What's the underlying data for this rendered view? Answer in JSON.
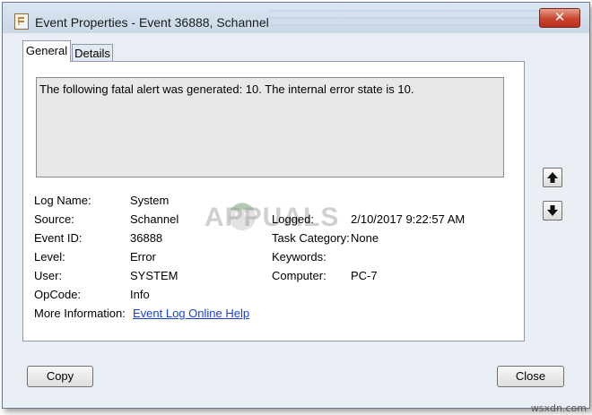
{
  "window": {
    "title": "Event Properties - Event 36888, Schannel",
    "close_label": "✕"
  },
  "tabs": [
    {
      "label": "General",
      "active": true
    },
    {
      "label": "Details",
      "active": false
    }
  ],
  "description": "The following fatal alert was generated: 10. The internal error state is 10.",
  "fields": {
    "log_name": {
      "label": "Log Name:",
      "value": "System"
    },
    "source": {
      "label": "Source:",
      "value": "Schannel"
    },
    "event_id": {
      "label": "Event ID:",
      "value": "36888"
    },
    "level": {
      "label": "Level:",
      "value": "Error"
    },
    "user": {
      "label": "User:",
      "value": "SYSTEM"
    },
    "opcode": {
      "label": "OpCode:",
      "value": "Info"
    },
    "more_info": {
      "label": "More Information:",
      "value": "Event Log Online Help"
    },
    "logged": {
      "label": "Logged:",
      "value": "2/10/2017 9:22:57 AM"
    },
    "task_category": {
      "label": "Task Category:",
      "value": "None"
    },
    "keywords": {
      "label": "Keywords:",
      "value": ""
    },
    "computer": {
      "label": "Computer:",
      "value": "PC-7"
    }
  },
  "buttons": {
    "copy": "Copy",
    "close": "Close",
    "up_arrow_icon": "arrow-up-icon",
    "down_arrow_icon": "arrow-down-icon"
  },
  "watermark": {
    "text": "APPUALS",
    "color": "#969696"
  },
  "site_mark": "wsxdn.com"
}
